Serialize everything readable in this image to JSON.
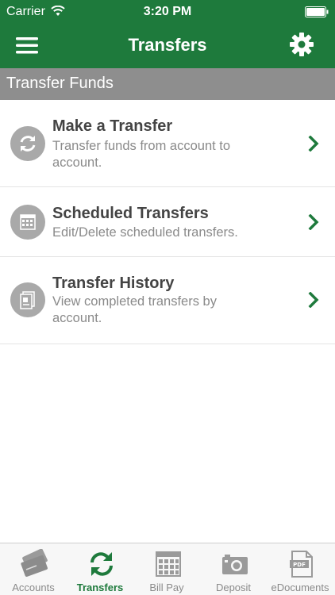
{
  "status_bar": {
    "carrier": "Carrier",
    "time": "3:20 PM"
  },
  "nav": {
    "title": "Transfers",
    "menu_icon": "hamburger-menu-icon",
    "settings_icon": "gear-icon"
  },
  "section": {
    "title": "Transfer Funds"
  },
  "items": [
    {
      "title": "Make a Transfer",
      "description": "Transfer funds from account to account.",
      "icon": "refresh-icon"
    },
    {
      "title": "Scheduled Transfers",
      "description": "Edit/Delete scheduled transfers.",
      "icon": "calendar-icon"
    },
    {
      "title": "Transfer History",
      "description": "View completed transfers by account.",
      "icon": "document-icon"
    }
  ],
  "tabs": [
    {
      "label": "Accounts",
      "icon": "cards-icon",
      "active": false
    },
    {
      "label": "Transfers",
      "icon": "transfer-arrows-icon",
      "active": true
    },
    {
      "label": "Bill Pay",
      "icon": "calendar-icon",
      "active": false
    },
    {
      "label": "Deposit",
      "icon": "camera-icon",
      "active": false
    },
    {
      "label": "eDocuments",
      "icon": "pdf-document-icon",
      "active": false
    }
  ],
  "colors": {
    "brand_green": "#1e7a3c",
    "section_gray": "#8e8e8e",
    "icon_gray": "#a9a9a9"
  }
}
